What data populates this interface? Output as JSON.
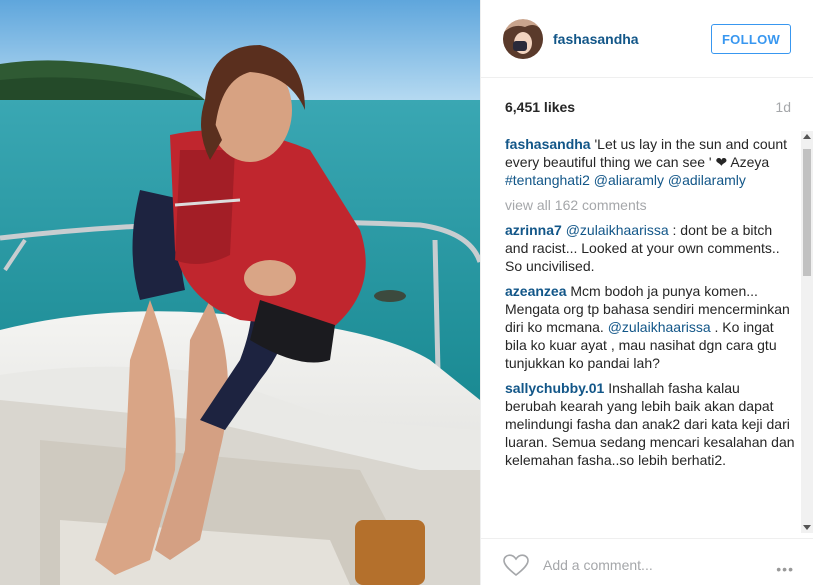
{
  "post": {
    "username": "fashasandha",
    "follow_label": "FOLLOW",
    "likes": "6,451 likes",
    "time_ago": "1d"
  },
  "caption": {
    "username": "fashasandha",
    "text": "'Let us lay in the sun and count every beautiful thing we can see ' ❤ Azeya",
    "tags": [
      "#tentanghati2",
      "@aliaramly",
      "@adilaramly"
    ]
  },
  "view_all": "view all 162 comments",
  "comments": [
    {
      "username": "azrinna7",
      "mention": "@zulaikhaarissa",
      "text": ": dont be a bitch and racist... Looked at your own comments.. So uncivilised."
    },
    {
      "username": "azeanzea",
      "text": "Mcm bodoh ja punya komen... Mengata org tp bahasa sendiri mencerminkan diri ko mcmana.",
      "mention": "@zulaikhaarissa",
      "text2": ". Ko ingat bila ko kuar ayat , mau nasihat dgn cara gtu tunjukkan ko pandai lah?"
    },
    {
      "username": "sallychubby.01",
      "text": "Inshallah fasha kalau berubah kearah yang lebih baik akan dapat melindungi fasha dan anak2 dari kata keji dari luaran. Semua sedang mencari kesalahan dan kelemahan fasha..so lebih berhati2."
    }
  ],
  "footer": {
    "add_comment_placeholder": "Add a comment...",
    "more": "•••",
    "heart_icon": "heart-outline-icon"
  },
  "colors": {
    "username": "#125688",
    "follow": "#3897f0",
    "muted": "#a5a7aa"
  }
}
